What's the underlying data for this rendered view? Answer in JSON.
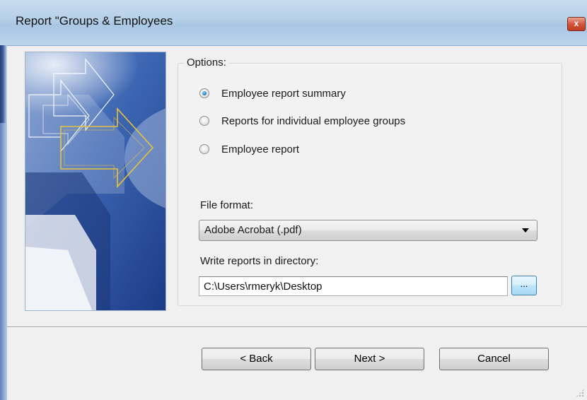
{
  "window": {
    "title": "Report \"Groups & Employees"
  },
  "titlebar": {
    "close_glyph": "x",
    "close_icon": "close-icon"
  },
  "options": {
    "legend": "Options:",
    "radios": [
      {
        "label": "Employee report summary",
        "checked": true
      },
      {
        "label": "Reports for individual employee groups",
        "checked": false
      },
      {
        "label": "Employee report",
        "checked": false
      }
    ]
  },
  "file_format": {
    "label": "File format:",
    "selected": "Adobe Acrobat (.pdf)",
    "icon": "chevron-down-icon"
  },
  "directory": {
    "label": "Write reports in directory:",
    "value": "C:\\Users\\rmeryk\\Desktop",
    "browse_label": "..."
  },
  "buttons": {
    "back": "< Back",
    "next": "Next >",
    "cancel": "Cancel"
  },
  "colors": {
    "titlebar": "#b5cfe8",
    "banner_dark": "#1e3f8f",
    "arrow_outline": "#e8c23a",
    "radio_selected": "#1f6fb8"
  }
}
